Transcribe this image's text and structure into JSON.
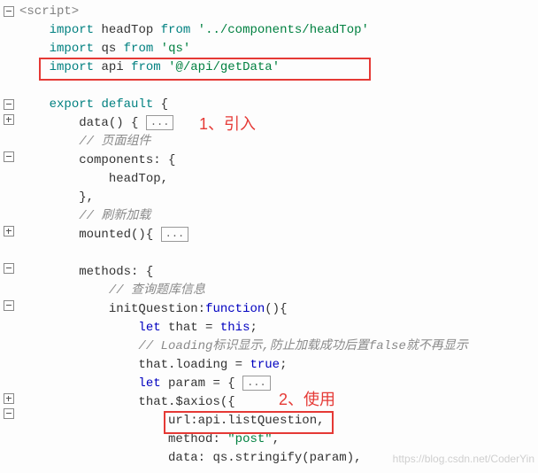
{
  "gutter": [
    "minus",
    "",
    "",
    "",
    "",
    "minus",
    "minus",
    "plus",
    "",
    "minus",
    "",
    "",
    "",
    "plus",
    "",
    "minus",
    "",
    "minus",
    "",
    "",
    "",
    "",
    "plus",
    "minus",
    ""
  ],
  "lines": {
    "l01_open": "<script>",
    "l02_kw": "import",
    "l02_id": "headTop",
    "l02_from": "from",
    "l02_str": "'../components/headTop'",
    "l03_kw": "import",
    "l03_id": "qs",
    "l03_from": "from",
    "l03_str": "'qs'",
    "l04_kw": "import",
    "l04_id": "api",
    "l04_from": "from",
    "l04_str": "'@/api/getData'",
    "l06_export": "export",
    "l06_default": "default",
    "l06_brace": " {",
    "l07_data": "data",
    "l07_paren": "() {",
    "l07_dots": "...",
    "l08_comment": "// 页面组件",
    "l09_components": "components",
    "l09_rest": ": {",
    "l10_head": "headTop",
    "l10_comma": ",",
    "l11_close": "},",
    "l12_comment": "// 刷新加载",
    "l13_mounted": "mounted",
    "l13_paren": "(){ ",
    "l13_dots": "...",
    "l15_methods": "methods",
    "l15_rest": ": {",
    "l16_comment": "// 查询题库信息",
    "l17_init": "initQuestion",
    "l17_colon": ":",
    "l17_func": "function",
    "l17_rest": "(){",
    "l18_let": "let",
    "l18_that": " that = ",
    "l18_this": "this",
    "l18_semi": ";",
    "l19_comment": "// Loading标识显示,防止加载成功后置false就不再显示",
    "l20_that": "that",
    "l20_loading": ".loading = ",
    "l20_true": "true",
    "l20_semi": ";",
    "l21_let": "let",
    "l21_param": " param = { ",
    "l21_dots": "...",
    "l22_that": "that",
    "l22_axios": ".$axios({",
    "l23_url": "url",
    "l23_col": ":",
    "l23_api": "api",
    "l23_list": ".listQuestion",
    "l23_comma": ",",
    "l24_method": "method",
    "l24_col": ": ",
    "l24_val": "\"post\"",
    "l24_comma": ",",
    "l25_data": "data",
    "l25_col": ": ",
    "l25_qs": "qs",
    "l25_stringify": ".stringify(param),"
  },
  "annotations": {
    "a1": "1、引入",
    "a2": "2、使用"
  },
  "watermark": "https://blog.csdn.net/CoderYin"
}
